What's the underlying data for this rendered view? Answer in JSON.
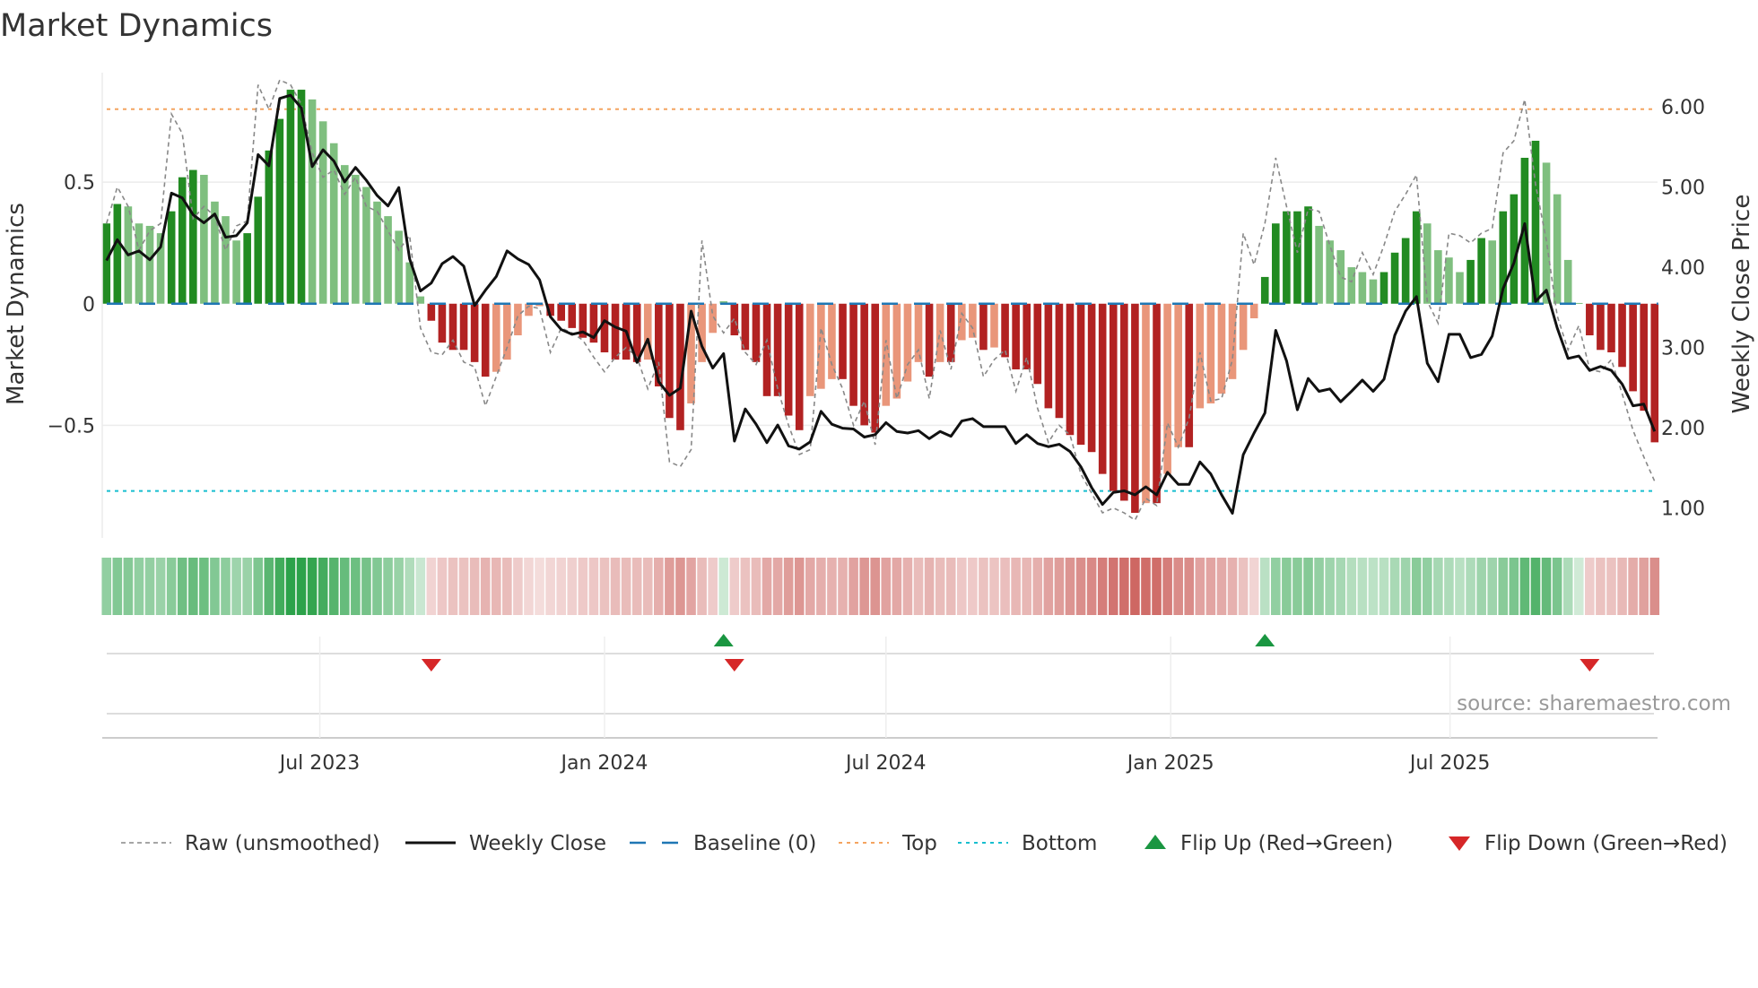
{
  "chart_data": {
    "type": "bar",
    "title": "Market Dynamics",
    "ylabel_left": "Market Dynamics",
    "ylabel_right": "Weekly Close Price",
    "left_ticks": [
      {
        "v": 0.5,
        "label": "0.5"
      },
      {
        "v": 0,
        "label": "0"
      },
      {
        "v": -0.5,
        "label": "−0.5"
      }
    ],
    "right_ticks": [
      {
        "v": 6,
        "label": "6.00"
      },
      {
        "v": 5,
        "label": "5.00"
      },
      {
        "v": 4,
        "label": "4.00"
      },
      {
        "v": 3,
        "label": "3.00"
      },
      {
        "v": 2,
        "label": "2.00"
      },
      {
        "v": 1,
        "label": "1.00"
      }
    ],
    "x_ticks": [
      {
        "week": 19.7,
        "label": "Jul 2023"
      },
      {
        "week": 46.0,
        "label": "Jan 2024"
      },
      {
        "week": 72.0,
        "label": "Jul 2024"
      },
      {
        "week": 98.3,
        "label": "Jan 2025"
      },
      {
        "week": 124.1,
        "label": "Jul 2025"
      }
    ],
    "top_level": 0.8,
    "bottom_level": -0.77,
    "baseline": 0,
    "momentum": [
      0.33,
      0.41,
      0.4,
      0.33,
      0.32,
      0.29,
      0.38,
      0.52,
      0.55,
      0.53,
      0.42,
      0.36,
      0.26,
      0.29,
      0.44,
      0.63,
      0.76,
      0.88,
      0.88,
      0.84,
      0.75,
      0.66,
      0.57,
      0.53,
      0.48,
      0.42,
      0.36,
      0.3,
      0.17,
      0.03,
      -0.07,
      -0.16,
      -0.19,
      -0.19,
      -0.24,
      -0.3,
      -0.28,
      -0.23,
      -0.13,
      -0.05,
      -0.01,
      -0.05,
      -0.07,
      -0.1,
      -0.14,
      -0.16,
      -0.2,
      -0.23,
      -0.23,
      -0.24,
      -0.23,
      -0.34,
      -0.47,
      -0.52,
      -0.41,
      -0.24,
      -0.12,
      0.01,
      -0.13,
      -0.19,
      -0.24,
      -0.38,
      -0.38,
      -0.46,
      -0.52,
      -0.38,
      -0.35,
      -0.31,
      -0.31,
      -0.42,
      -0.5,
      -0.53,
      -0.42,
      -0.39,
      -0.32,
      -0.24,
      -0.3,
      -0.24,
      -0.24,
      -0.15,
      -0.14,
      -0.19,
      -0.18,
      -0.22,
      -0.27,
      -0.27,
      -0.33,
      -0.43,
      -0.47,
      -0.54,
      -0.58,
      -0.61,
      -0.7,
      -0.77,
      -0.81,
      -0.86,
      -0.82,
      -0.82,
      -0.7,
      -0.59,
      -0.59,
      -0.43,
      -0.41,
      -0.37,
      -0.31,
      -0.19,
      -0.06,
      0.11,
      0.33,
      0.38,
      0.38,
      0.4,
      0.32,
      0.26,
      0.22,
      0.15,
      0.13,
      0.1,
      0.13,
      0.21,
      0.27,
      0.38,
      0.33,
      0.22,
      0.19,
      0.13,
      0.18,
      0.27,
      0.26,
      0.38,
      0.45,
      0.6,
      0.67,
      0.58,
      0.45,
      0.18,
      0.003,
      -0.13,
      -0.19,
      -0.2,
      -0.26,
      -0.36,
      -0.44,
      -0.57
    ],
    "raw": [
      0.33,
      0.48,
      0.4,
      0.22,
      0.3,
      0.33,
      0.78,
      0.7,
      0.35,
      0.4,
      0.36,
      0.22,
      0.32,
      0.34,
      0.9,
      0.8,
      0.92,
      0.9,
      0.82,
      0.62,
      0.52,
      0.55,
      0.45,
      0.52,
      0.4,
      0.38,
      0.3,
      0.22,
      0.28,
      -0.1,
      -0.2,
      -0.21,
      -0.15,
      -0.24,
      -0.26,
      -0.42,
      -0.3,
      -0.18,
      -0.05,
      -0.01,
      -0.02,
      -0.2,
      -0.1,
      -0.12,
      -0.15,
      -0.22,
      -0.28,
      -0.22,
      -0.18,
      -0.22,
      -0.35,
      -0.24,
      -0.65,
      -0.67,
      -0.6,
      0.26,
      -0.05,
      -0.12,
      -0.06,
      -0.2,
      -0.25,
      -0.15,
      -0.35,
      -0.5,
      -0.62,
      -0.6,
      -0.1,
      -0.25,
      -0.35,
      -0.5,
      -0.4,
      -0.58,
      -0.15,
      -0.39,
      -0.25,
      -0.19,
      -0.39,
      -0.11,
      -0.27,
      -0.04,
      -0.1,
      -0.3,
      -0.23,
      -0.19,
      -0.36,
      -0.22,
      -0.43,
      -0.57,
      -0.5,
      -0.54,
      -0.7,
      -0.78,
      -0.86,
      -0.84,
      -0.86,
      -0.89,
      -0.8,
      -0.83,
      -0.49,
      -0.59,
      -0.47,
      -0.2,
      -0.4,
      -0.39,
      -0.23,
      0.29,
      0.16,
      0.33,
      0.6,
      0.4,
      0.21,
      0.39,
      0.38,
      0.24,
      0.11,
      0.09,
      0.21,
      0.12,
      0.24,
      0.38,
      0.45,
      0.53,
      0.01,
      -0.08,
      0.29,
      0.28,
      0.25,
      0.29,
      0.31,
      0.62,
      0.67,
      0.84,
      0.49,
      0.26,
      -0.05,
      -0.19,
      -0.09,
      -0.27,
      -0.28,
      -0.23,
      -0.37,
      -0.52,
      -0.63,
      -0.73
    ],
    "close": [
      4.08,
      4.34,
      4.15,
      4.2,
      4.09,
      4.25,
      4.92,
      4.86,
      4.65,
      4.55,
      4.66,
      4.37,
      4.39,
      4.55,
      5.4,
      5.26,
      6.1,
      6.14,
      5.98,
      5.25,
      5.46,
      5.32,
      5.06,
      5.24,
      5.08,
      4.89,
      4.76,
      4.99,
      4.1,
      3.7,
      3.8,
      4.04,
      4.13,
      4.01,
      3.52,
      3.71,
      3.88,
      4.2,
      4.1,
      4.03,
      3.84,
      3.38,
      3.22,
      3.16,
      3.19,
      3.12,
      3.33,
      3.25,
      3.2,
      2.81,
      3.1,
      2.57,
      2.4,
      2.49,
      3.45,
      3.01,
      2.74,
      2.92,
      1.83,
      2.23,
      2.04,
      1.81,
      2.03,
      1.77,
      1.73,
      1.82,
      2.2,
      2.04,
      1.99,
      1.98,
      1.88,
      1.91,
      2.06,
      1.95,
      1.93,
      1.96,
      1.86,
      1.95,
      1.89,
      2.08,
      2.11,
      2.01,
      2.01,
      2.01,
      1.8,
      1.91,
      1.8,
      1.76,
      1.79,
      1.7,
      1.51,
      1.25,
      1.04,
      1.19,
      1.21,
      1.16,
      1.26,
      1.16,
      1.44,
      1.29,
      1.29,
      1.57,
      1.42,
      1.16,
      0.93,
      1.66,
      1.93,
      2.18,
      3.21,
      2.83,
      2.22,
      2.61,
      2.45,
      2.48,
      2.32,
      2.45,
      2.59,
      2.45,
      2.6,
      3.15,
      3.45,
      3.63,
      2.8,
      2.57,
      3.16,
      3.16,
      2.87,
      2.91,
      3.14,
      3.73,
      4.05,
      4.54,
      3.57,
      3.71,
      3.24,
      2.86,
      2.89,
      2.71,
      2.76,
      2.71,
      2.54,
      2.27,
      2.29,
      1.95
    ],
    "colors": {
      "pos_strong": "#228b22",
      "pos_weak": "#7fbf7f",
      "neg_strong": "#b22222",
      "neg_weak": "#e9967a",
      "close": "#111111",
      "raw": "#888888",
      "baseline": "#1f77b4",
      "top": "#f4a460",
      "bottom": "#17becf",
      "flip_up": "#1a9641",
      "flip_down": "#d62728"
    },
    "legend": [
      {
        "key": "raw",
        "label": "Raw (unsmoothed)"
      },
      {
        "key": "close",
        "label": "Weekly Close"
      },
      {
        "key": "baseline",
        "label": "Baseline (0)"
      },
      {
        "key": "top",
        "label": "Top"
      },
      {
        "key": "bottom",
        "label": "Bottom"
      },
      {
        "key": "flip_up",
        "label": "Flip Up (Red→Green)"
      },
      {
        "key": "flip_down",
        "label": "Flip Down (Green→Red)"
      }
    ],
    "source": "source: sharemaestro.com"
  }
}
